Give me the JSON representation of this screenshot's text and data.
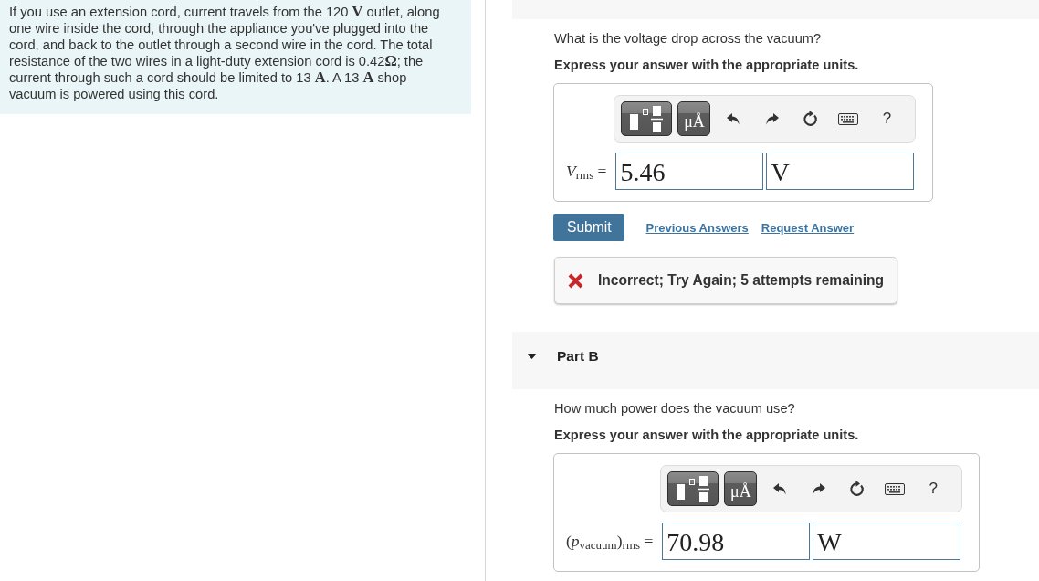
{
  "problem": {
    "text": "If you use an extension cord, current travels from the 120 **V** outlet, along one wire inside the cord, through the appliance you've plugged into the cord, and back to the outlet through a second wire in the cord. The total resistance of the two wires in a light-duty extension cord is 0.42**Ω**; the current through such a cord should be limited to 13 **A**. A 13 **A** shop vacuum is powered using this cord."
  },
  "parts": [
    {
      "question": "What is the voltage drop across the vacuum?",
      "instruction": "Express your answer with the appropriate units.",
      "answer": {
        "toolbar": {
          "units": "μÅ",
          "help": "?"
        },
        "label": "*V*$_{rms}$ =",
        "value": "5.46",
        "unit": "V"
      },
      "submit": "Submit",
      "links": [
        "Previous Answers",
        "Request Answer"
      ],
      "feedback": {
        "kind": "incorrect",
        "text": "Incorrect; Try Again; 5 attempts remaining"
      }
    },
    {
      "title": "Part B",
      "expanded": true,
      "question": "How much power does the vacuum use?",
      "instruction": "Express your answer with the appropriate units.",
      "answer": {
        "toolbar": {
          "units": "μÅ",
          "help": "?"
        },
        "label": "(*p*$_{vacuum}$)$_{rms}$ =",
        "value": "70.98",
        "unit": "W"
      }
    }
  ]
}
